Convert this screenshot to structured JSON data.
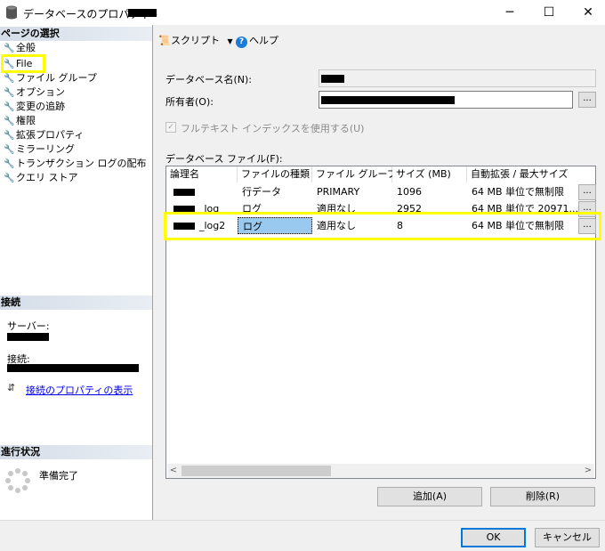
{
  "window": {
    "title": "データベースのプロパティ - ",
    "minimize": "─",
    "maximize": "☐",
    "close": "✕"
  },
  "left": {
    "page_select_header": "ページの選択",
    "pages": [
      {
        "label": "全般"
      },
      {
        "label": "File"
      },
      {
        "label": "ファイル グループ"
      },
      {
        "label": "オプション"
      },
      {
        "label": "変更の追跡"
      },
      {
        "label": "権限"
      },
      {
        "label": "拡張プロパティ"
      },
      {
        "label": "ミラーリング"
      },
      {
        "label": "トランザクション ログの配布"
      },
      {
        "label": "クエリ ストア"
      }
    ],
    "connection_header": "接続",
    "server_label": "サーバー:",
    "connection_label": "接続:",
    "view_connection_link": "接続のプロパティの表示",
    "progress_header": "進行状況",
    "progress_status": "準備完了"
  },
  "toolbar": {
    "script_label": "スクリプト",
    "help_label": "ヘルプ"
  },
  "form": {
    "db_name_label": "データベース名(N):",
    "owner_label": "所有者(O):",
    "fulltext_label": "フルテキスト インデックスを使用する(U)",
    "db_files_label": "データベース ファイル(F):",
    "browse_label": "..."
  },
  "grid": {
    "headers": [
      "論理名",
      "ファイルの種類",
      "ファイル グループ",
      "サイズ (MB)",
      "自動拡張 / 最大サイズ"
    ],
    "rows": [
      {
        "name_suffix": "",
        "type": "行データ",
        "group": "PRIMARY",
        "size": "1096",
        "growth": "64 MB 単位で無制限"
      },
      {
        "name_suffix": "_log",
        "type": "ログ",
        "group": "適用なし",
        "size": "2952",
        "growth": "64 MB 単位で 20971..."
      },
      {
        "name_suffix": "_log2",
        "type": "ログ",
        "group": "適用なし",
        "size": "8",
        "growth": "64 MB 単位で無制限"
      }
    ],
    "scroll_left": "<",
    "scroll_right": ">"
  },
  "buttons": {
    "add": "追加(A)",
    "remove": "削除(R)",
    "ok": "OK",
    "cancel": "キャンセル"
  },
  "colors": {
    "highlight": "#ffff00",
    "selection": "#99c9ef",
    "link": "#0000ee",
    "header_gradient": "#d4dde8"
  }
}
